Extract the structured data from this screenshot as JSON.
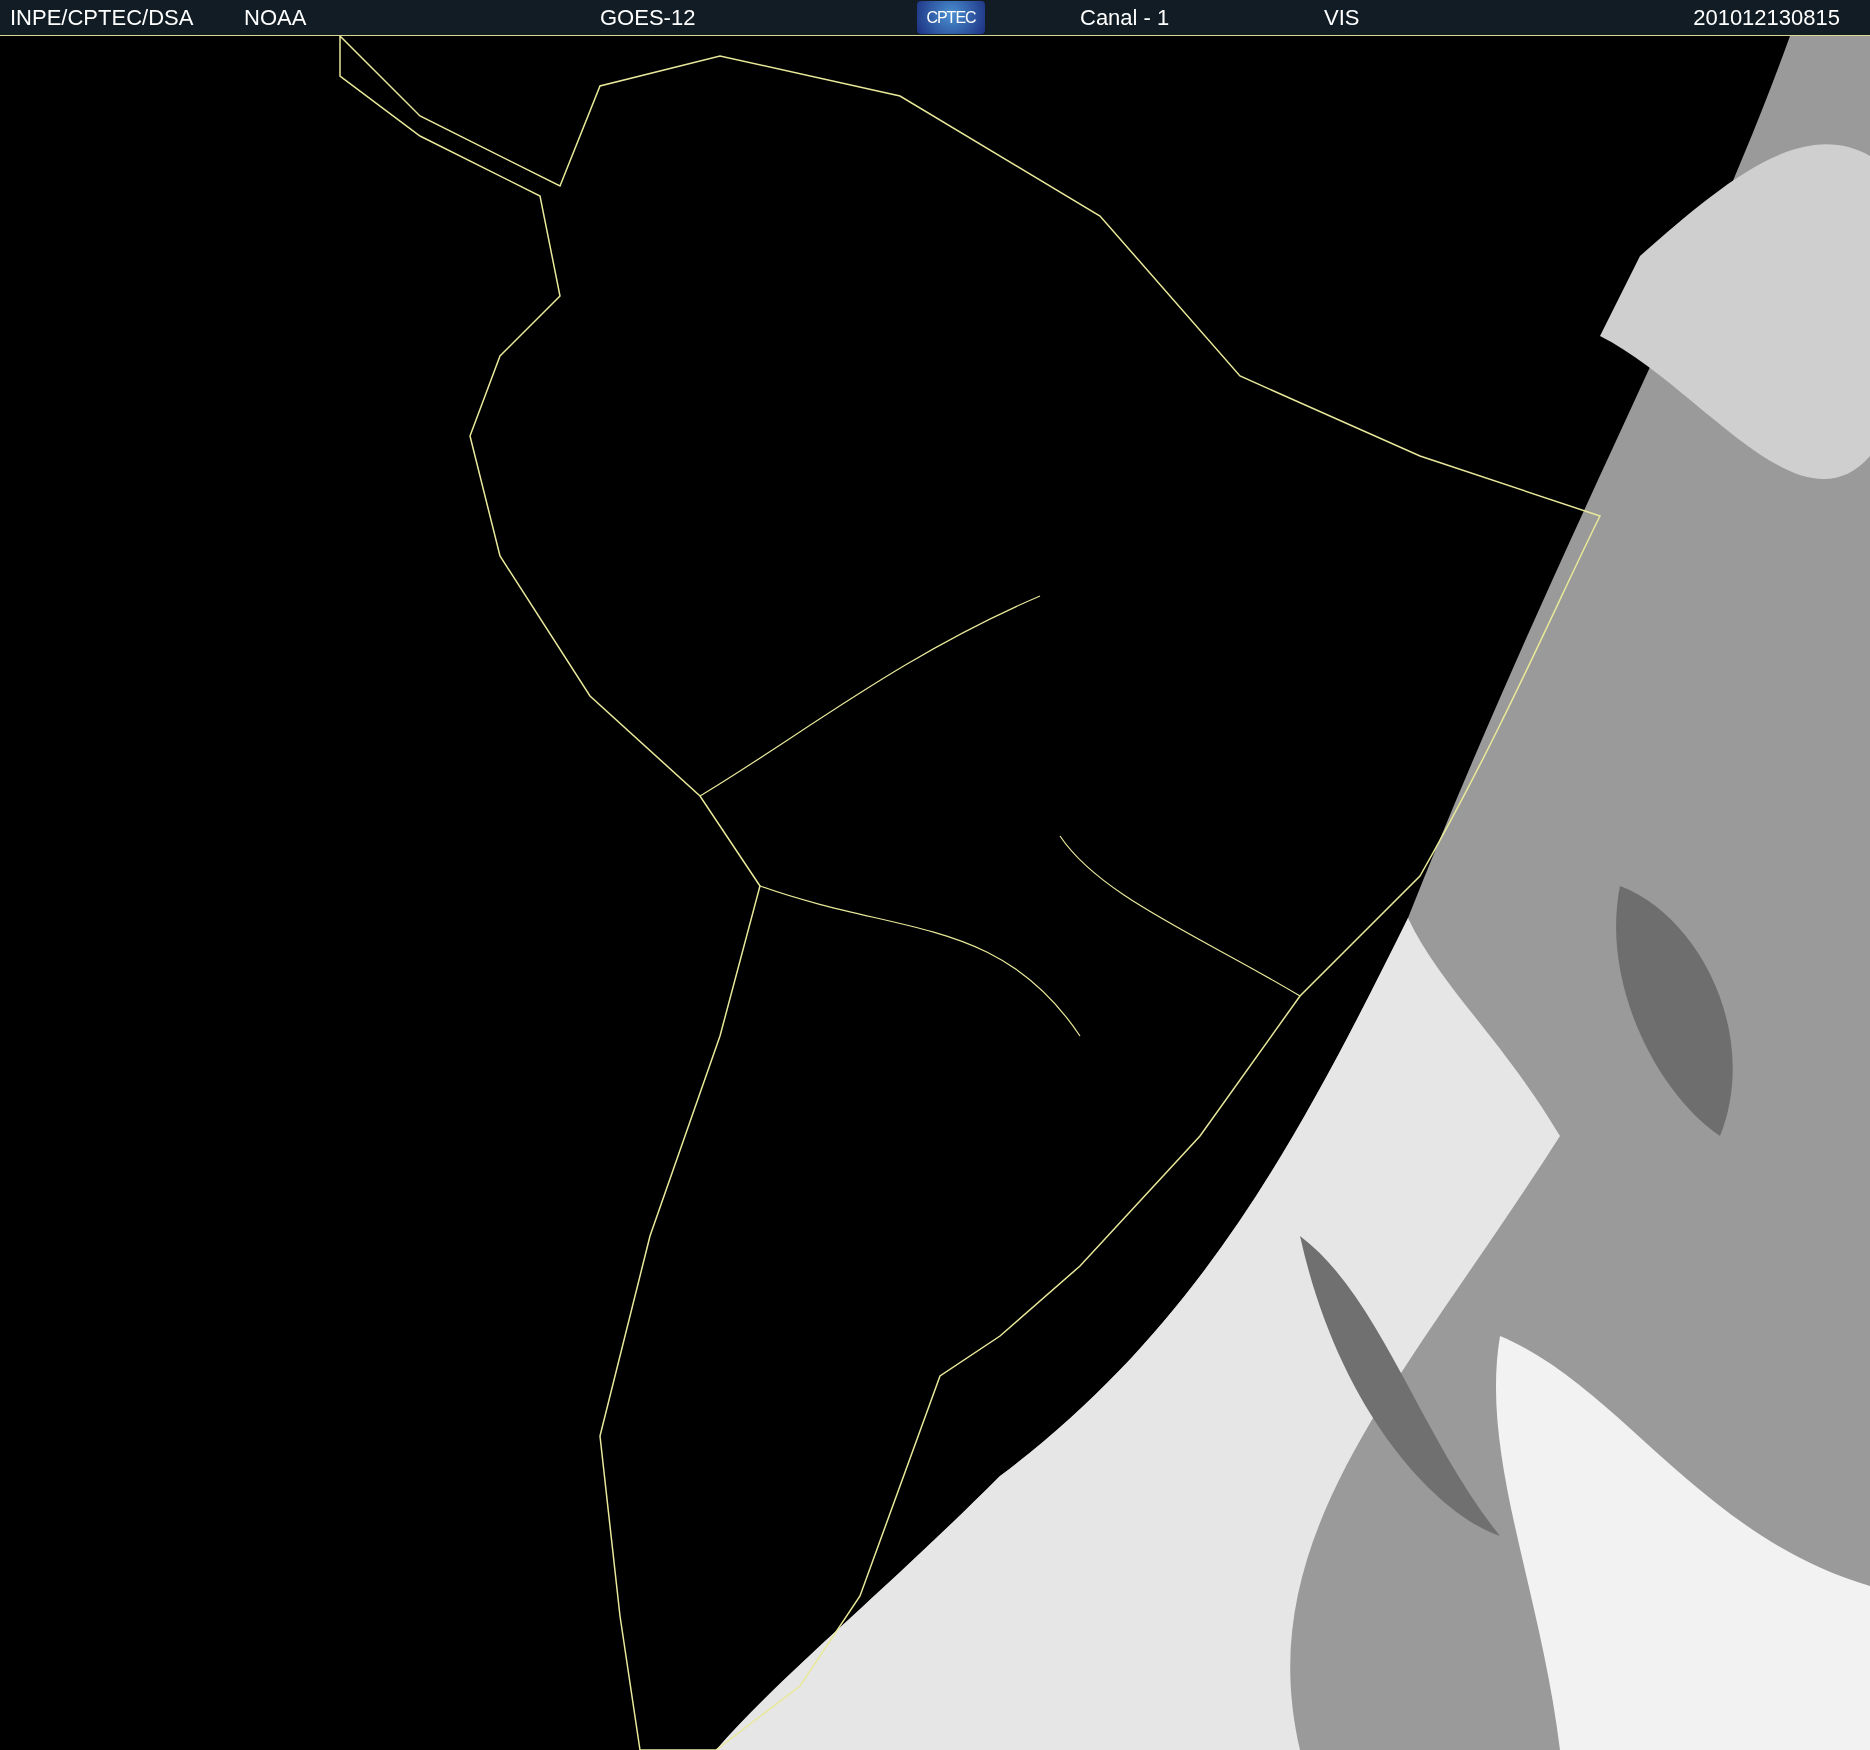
{
  "header": {
    "source": "INPE/CPTEC/DSA",
    "agency": "NOAA",
    "satellite": "GOES-12",
    "logo": "CPTEC",
    "channel": "Canal - 1",
    "band": "VIS",
    "timestamp": "201012130815"
  }
}
